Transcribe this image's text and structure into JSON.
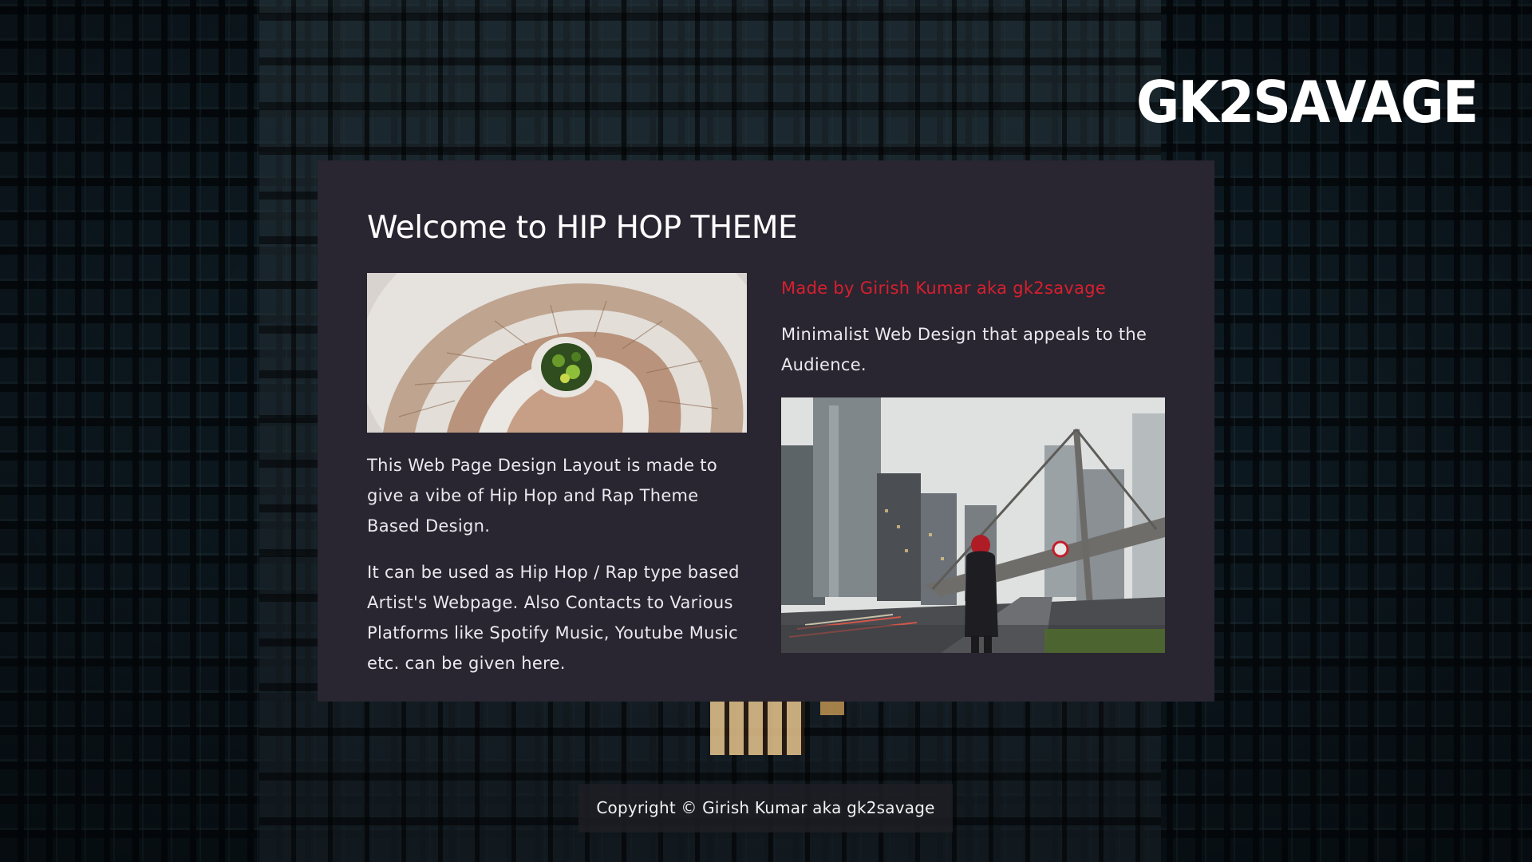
{
  "brand": {
    "logo_text": "GK2SAVAGE"
  },
  "main": {
    "title": "Welcome to HIP HOP THEME",
    "left_column": {
      "image_alt": "Spiral staircase with greenery at the center, viewed from above",
      "paragraph_1": "This Web Page Design Layout is made to give a vibe of Hip Hop and Rap Theme Based Design.",
      "paragraph_2": "It can be used as Hip Hop / Rap type based Artist's Webpage. Also Contacts to Various Platforms like Spotify Music, Youtube Music etc. can be given here."
    },
    "right_column": {
      "made_by": "Made by Girish Kumar aka gk2savage",
      "tagline": "Minimalist Web Design that appeals to the Audience.",
      "image_alt": "Person in hooded jacket walking along a city street under a pedestrian bridge"
    }
  },
  "footer": {
    "copyright": "Copyright © Girish Kumar aka gk2savage"
  },
  "colors": {
    "panel_background": "#292631",
    "accent_red": "#d91f2e",
    "text_light": "#ece8ee",
    "footer_background": "#1e1e24"
  }
}
